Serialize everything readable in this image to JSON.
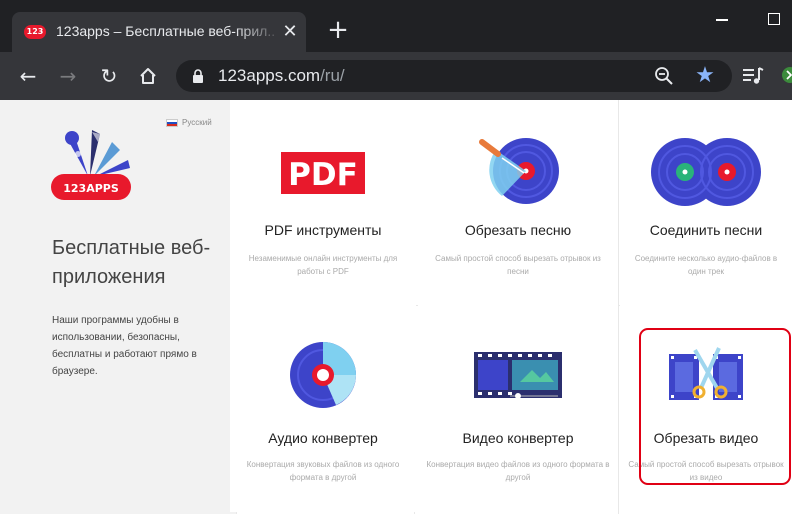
{
  "browser": {
    "tab": {
      "favicon_text": "123",
      "title": "123apps – Бесплатные веб-прил..."
    },
    "toolbar": {
      "url_host": "123apps.com",
      "url_path": "/ru/"
    }
  },
  "sidebar": {
    "language": "Русский",
    "logo_text": "123APPS",
    "hero_title": "Бесплатные веб-приложения",
    "hero_text": "Наши программы удобны в использовании, безопасны, бесплатны и работают прямо в браузере."
  },
  "tools": [
    {
      "title": "PDF инструменты",
      "desc": "Незаменимые онлайн инструменты для работы с PDF",
      "icon": "pdf-icon"
    },
    {
      "title": "Обрезать песню",
      "desc": "Самый простой способ вырезать отрывок из песни",
      "icon": "cut-song-icon"
    },
    {
      "title": "Соединить песни",
      "desc": "Соедините несколько аудио-файлов в один трек",
      "icon": "join-songs-icon"
    },
    {
      "title": "Аудио конвертер",
      "desc": "Конвертация звуковых файлов из одного формата в другой",
      "icon": "audio-converter-icon"
    },
    {
      "title": "Видео конвертер",
      "desc": "Конвертация видео файлов из одного формата в другой",
      "icon": "video-converter-icon"
    },
    {
      "title": "Обрезать видео",
      "desc": "Самый простой способ вырезать отрывок из видео",
      "icon": "cut-video-icon"
    }
  ],
  "colors": {
    "accent_red": "#e8192c",
    "highlight": "#e00014",
    "vinyl_blue": "#3d44c9",
    "star_blue": "#8ab4f8"
  }
}
